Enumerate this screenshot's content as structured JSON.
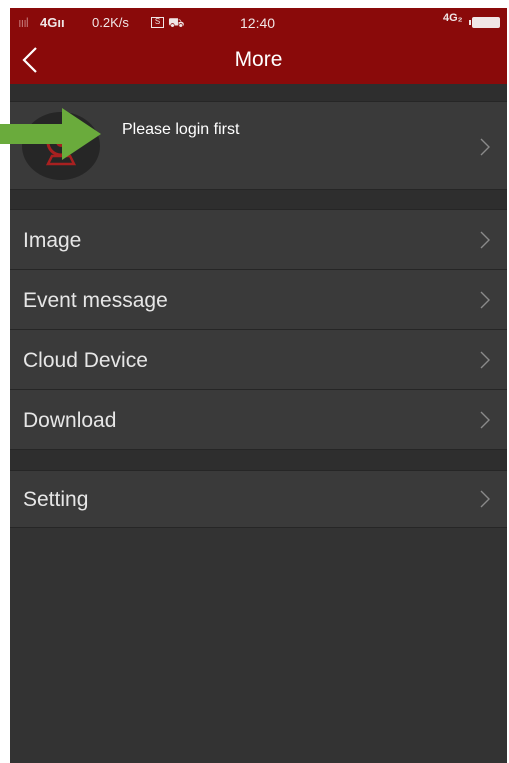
{
  "status_bar": {
    "signal": "ıııl",
    "network": "4Gıı",
    "speed": "0.2K/s",
    "sim_icon_text": "S",
    "time": "12:40",
    "network_right": "4G₂",
    "battery_icon": "battery-icon"
  },
  "header": {
    "title": "More",
    "back_icon": "chevron-left-icon"
  },
  "login": {
    "text": "Please login first",
    "avatar_icon": "webcam-icon"
  },
  "menu": [
    {
      "label": "Image"
    },
    {
      "label": "Event message"
    },
    {
      "label": "Cloud Device"
    },
    {
      "label": "Download"
    }
  ],
  "settings": {
    "label": "Setting"
  },
  "annotation": {
    "arrow_color": "#6aab3c"
  },
  "colors": {
    "header_bg": "#8a0a0a",
    "body_bg": "#333333",
    "row_bg": "#3a3a3a",
    "text": "#e6e6e6"
  }
}
